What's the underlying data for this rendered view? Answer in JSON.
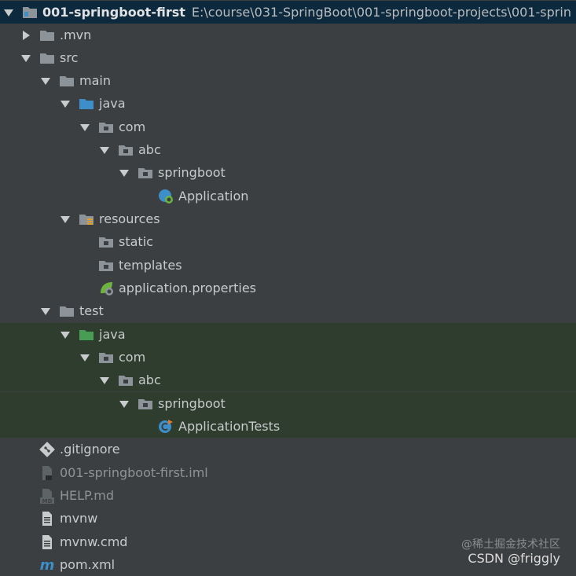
{
  "project": {
    "name": "001-springboot-first",
    "path": "E:\\course\\031-SpringBoot\\001-springboot-projects\\001-sprin"
  },
  "tree": {
    "mvn": ".mvn",
    "src": "src",
    "main": "main",
    "main_java": "java",
    "main_com": "com",
    "main_abc": "abc",
    "main_springboot": "springboot",
    "application": "Application",
    "resources": "resources",
    "static": "static",
    "templates": "templates",
    "app_properties": "application.properties",
    "test": "test",
    "test_java": "java",
    "test_com": "com",
    "test_abc": "abc",
    "test_springboot": "springboot",
    "application_tests": "ApplicationTests",
    "gitignore": ".gitignore",
    "iml": "001-springboot-first.iml",
    "help_md": "HELP.md",
    "md_badge": "MD",
    "mvnw": "mvnw",
    "mvnw_cmd": "mvnw.cmd",
    "pom": "pom.xml",
    "maven_icon_letter": "m"
  },
  "watermark": {
    "line1": "@稀土掘金技术社区",
    "line2": "CSDN @friggly"
  },
  "colors": {
    "background": "#3c3f41",
    "selected_row": "#0d293e",
    "test_rows": "#2e3d2e",
    "folder": "#8d9499",
    "source_folder": "#3d8fc9",
    "test_folder": "#499c54",
    "spring": "#6db33f",
    "text": "#c8cbcc"
  },
  "icons": [
    "expand-arrow-icon",
    "collapse-arrow-icon",
    "module-icon",
    "folder-icon",
    "source-folder-icon",
    "test-folder-icon",
    "package-icon",
    "spring-boot-class-icon",
    "resources-folder-icon",
    "spring-properties-icon",
    "test-class-icon",
    "git-icon",
    "iml-file-icon",
    "markdown-file-icon",
    "text-file-icon",
    "maven-icon"
  ]
}
